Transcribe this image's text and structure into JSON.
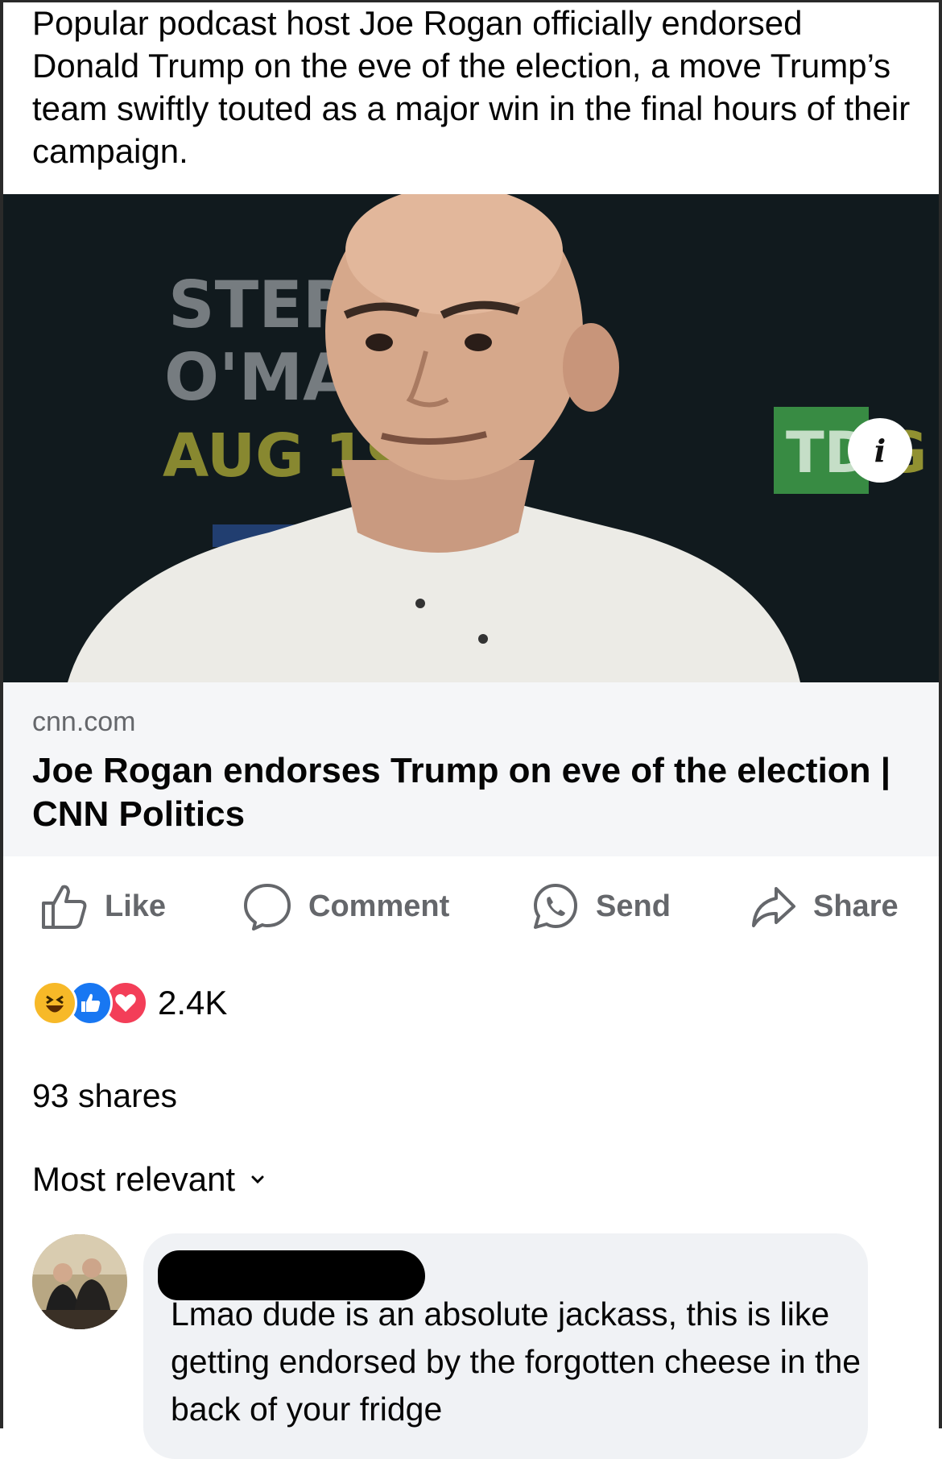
{
  "post": {
    "caption": "Popular podcast host Joe Rogan officially endorsed Donald Trump on the eve of the election, a move Trump’s team swiftly touted as a major win in the final hours of their campaign."
  },
  "image": {
    "info_icon": "i",
    "background_signs": [
      "STERL",
      "O'MA",
      "AUG 19",
      "TD",
      "G"
    ]
  },
  "link_preview": {
    "domain": "cnn.com",
    "title": "Joe Rogan endorses Trump on eve of the election | CNN Politics"
  },
  "actions": [
    {
      "label": "Like",
      "icon": "thumbs-up-icon"
    },
    {
      "label": "Comment",
      "icon": "comment-bubble-icon"
    },
    {
      "label": "Send",
      "icon": "whatsapp-icon"
    },
    {
      "label": "Share",
      "icon": "share-arrow-icon"
    }
  ],
  "reactions": {
    "types": [
      "haha",
      "like",
      "love"
    ],
    "count": "2.4K",
    "colors": {
      "haha": "#f7b928",
      "like": "#1877f2",
      "love": "#f33e58"
    }
  },
  "shares_text": "93 shares",
  "comments": {
    "sort_label": "Most relevant",
    "items": [
      {
        "text": "Lmao dude is an absolute jackass, this is like getting endorsed by the forgotten cheese in the back of your fridge"
      }
    ]
  },
  "colors": {
    "secondary_text": "#65676b",
    "card_bg": "#f5f6f8",
    "bubble_bg": "#f0f2f5"
  }
}
